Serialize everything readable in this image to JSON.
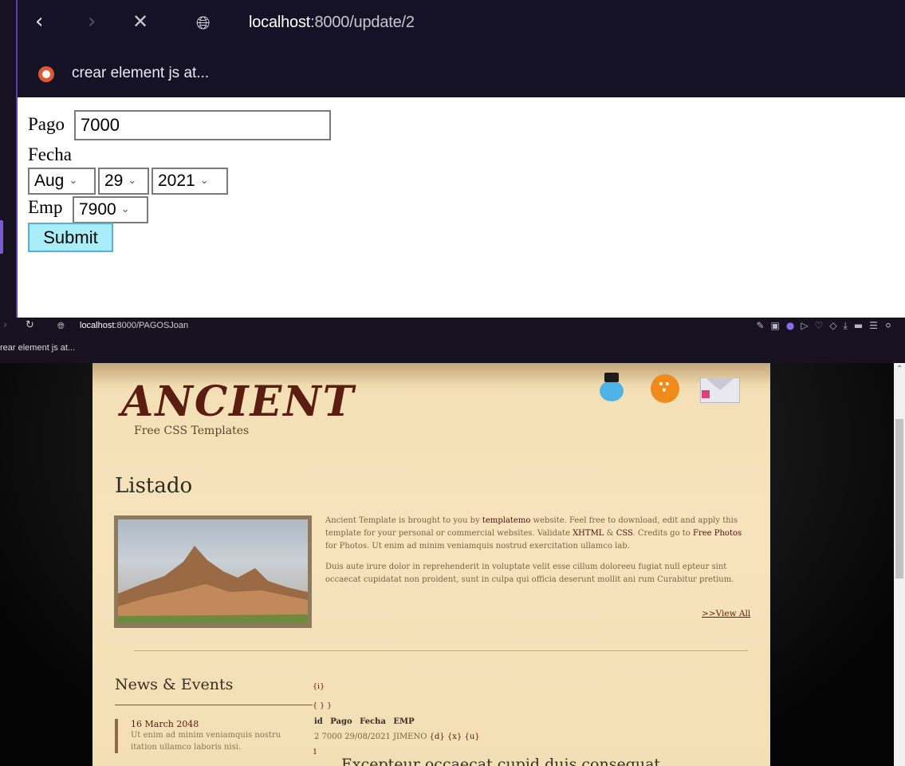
{
  "top_window": {
    "url_host": "localhost",
    "url_path": ":8000/update/2",
    "bookmark": "crear element js at...",
    "form": {
      "pago_label": "Pago",
      "pago_value": "7000",
      "fecha_label": "Fecha",
      "month": "Aug",
      "day": "29",
      "year": "2021",
      "emp_label": "Emp",
      "emp_value": "7900",
      "submit_label": "Submit"
    }
  },
  "bottom_window": {
    "url_host": "localhost",
    "url_path": ":8000/PAGOSJoan",
    "bookmark": "rear element js at...",
    "site": {
      "logo": "ANCIENT",
      "logo_sub": "Free CSS Templates",
      "heading": "Listado",
      "intro_p1_a": "Ancient Template is brought to you by ",
      "intro_p1_link1": "templatemo",
      "intro_p1_b": " website. Feel free to download, edit and apply this template for your personal or commercial websites. Validate ",
      "intro_p1_link2": "XHTML",
      "intro_p1_c": " & ",
      "intro_p1_link3": "CSS",
      "intro_p1_d": ". Credits go to ",
      "intro_p1_link4": "Free Photos",
      "intro_p1_e": " for Photos. Ut enim ad minim veniamquis nostrud exercitation ullamco lab.",
      "intro_p2": "Duis aute irure dolor in reprehenderit in voluptate velit esse cillum doloreeu fugiat null epteur sint occaecat cupidatat non proident, sunt in culpa qui officia deserunt mollit ani rum Curabitur pretium.",
      "view_all": ">>View All",
      "news_title": "News & Events",
      "news_date": "16 March 2048",
      "news_text": "Ut enim ad minim veniamquis nostru itation ullamco laboris nisi.",
      "tpl_i": "{i}",
      "tpl_braces": "{ } }",
      "table_headers": [
        "id",
        "Pago",
        "Fecha",
        "EMP"
      ],
      "table_row": "2  7000 29/08/2021 JIMENO",
      "row_tags": "{d} {x} {u}",
      "row_next": "1",
      "big_line": "Excepteur occaecat cupid duis consequat"
    }
  }
}
